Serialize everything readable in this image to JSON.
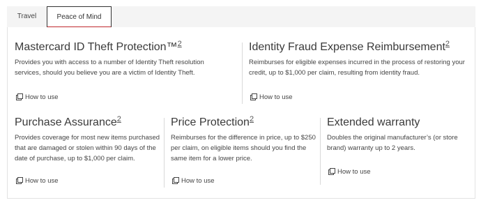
{
  "tabs": [
    {
      "label": "Travel",
      "active": false
    },
    {
      "label": "Peace of Mind",
      "active": true
    }
  ],
  "features": [
    {
      "title": "Mastercard ID Theft Protection™",
      "sup": "2",
      "description": "Provides you with access to a number of Identity Theft resolution services, should you believe you are a victim of Identity Theft.",
      "link": "How to use",
      "link_icon": "copy-icon"
    },
    {
      "title": "Identity Fraud Expense Reimbursement",
      "sup": "2",
      "description": "Reimburses for eligible expenses incurred in the process of restoring your credit, up to $1,000 per claim, resulting from identity fraud.",
      "link": "How to use",
      "link_icon": "copy-icon"
    },
    {
      "title": "Purchase Assurance",
      "sup": "2",
      "description": "Provides coverage for most new items purchased that are damaged or stolen within 90 days of the date of purchase, up to $1,000 per claim.",
      "link": "How to use",
      "link_icon": "copy-icon"
    },
    {
      "title": "Price Protection",
      "sup": "2",
      "description": "Reimburses for the difference in price, up to $250 per claim, on eligible items should you find the same item for a lower price.",
      "link": "How to use",
      "link_icon": "copy-icon"
    },
    {
      "title": "Extended warranty",
      "sup": "",
      "description": "Doubles the original manufacturer’s (or store brand) warranty up to 2 years.",
      "link": "How to use",
      "link_icon": "copy-icon"
    }
  ],
  "colors": {
    "accent": "#c0272d",
    "tab_bar": "#f4f4f4",
    "divider": "#d9d9d9"
  }
}
